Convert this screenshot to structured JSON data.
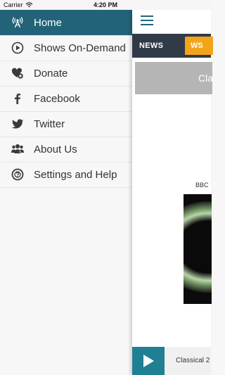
{
  "status_bar": {
    "carrier": "Carrier",
    "time": "4:20 PM"
  },
  "drawer": {
    "items": [
      {
        "label": "Home",
        "icon": "radio-tower-icon",
        "active": true
      },
      {
        "label": "Shows On-Demand",
        "icon": "play-circle-icon"
      },
      {
        "label": "Donate",
        "icon": "heart-plus-icon"
      },
      {
        "label": "Facebook",
        "icon": "facebook-icon"
      },
      {
        "label": "Twitter",
        "icon": "twitter-icon"
      },
      {
        "label": "About Us",
        "icon": "people-icon"
      },
      {
        "label": "Settings and Help",
        "icon": "help-circle-icon"
      }
    ]
  },
  "main": {
    "tabs": [
      {
        "label": "NEWS"
      },
      {
        "label": "WS"
      }
    ],
    "banner_text": "Cla",
    "art_caption": "BBC",
    "player": {
      "now_playing": "Classical 2"
    }
  },
  "colors": {
    "drawer_active": "#22637a",
    "tab_bar": "#313b47",
    "tab_active": "#f2a51b",
    "player_button": "#1f7f93"
  }
}
